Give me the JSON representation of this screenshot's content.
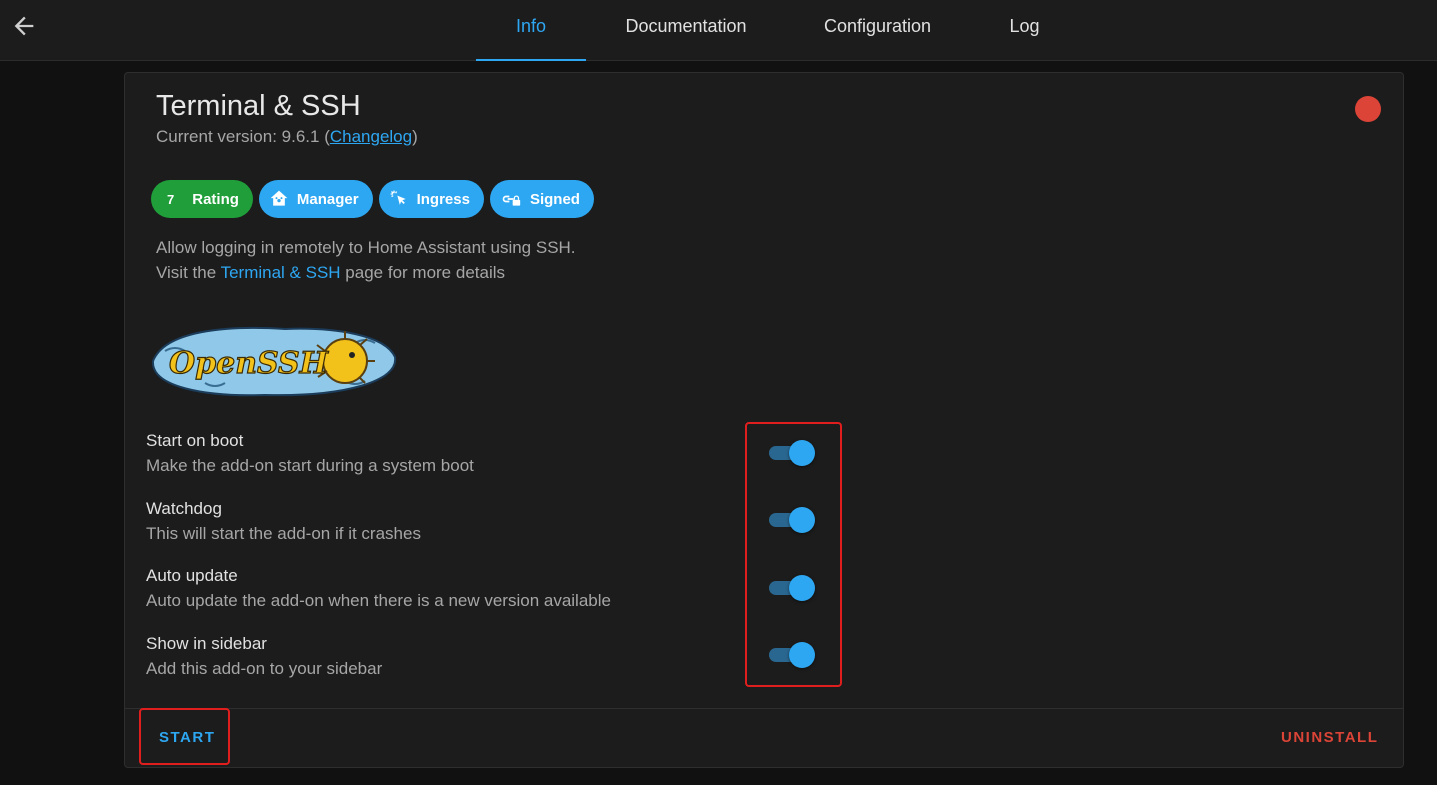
{
  "tabs": [
    {
      "label": "Info",
      "active": true
    },
    {
      "label": "Documentation",
      "active": false
    },
    {
      "label": "Configuration",
      "active": false
    },
    {
      "label": "Log",
      "active": false
    }
  ],
  "addon": {
    "title": "Terminal & SSH",
    "version_prefix": "Current version: 9.6.1 (",
    "changelog_label": "Changelog",
    "version_suffix": ")",
    "status_color": "#db4437"
  },
  "badges": {
    "rating_value": "7",
    "rating_label": "Rating",
    "manager_label": "Manager",
    "ingress_label": "Ingress",
    "signed_label": "Signed"
  },
  "description": {
    "line1": "Allow logging in remotely to Home Assistant using SSH.",
    "line2_prefix": "Visit the ",
    "line2_link": "Terminal & SSH",
    "line2_suffix": " page for more details"
  },
  "logo_text": "OpenSSH",
  "options": [
    {
      "title": "Start on boot",
      "description": "Make the add-on start during a system boot",
      "enabled": true
    },
    {
      "title": "Watchdog",
      "description": "This will start the add-on if it crashes",
      "enabled": true
    },
    {
      "title": "Auto update",
      "description": "Auto update the add-on when there is a new version available",
      "enabled": true
    },
    {
      "title": "Show in sidebar",
      "description": "Add this add-on to your sidebar",
      "enabled": true
    }
  ],
  "actions": {
    "start_label": "START",
    "uninstall_label": "UNINSTALL"
  },
  "colors": {
    "accent": "#2ea7f2",
    "danger": "#db4437",
    "rating_green": "#1f9e3a",
    "highlight_red": "#e01e1e"
  }
}
